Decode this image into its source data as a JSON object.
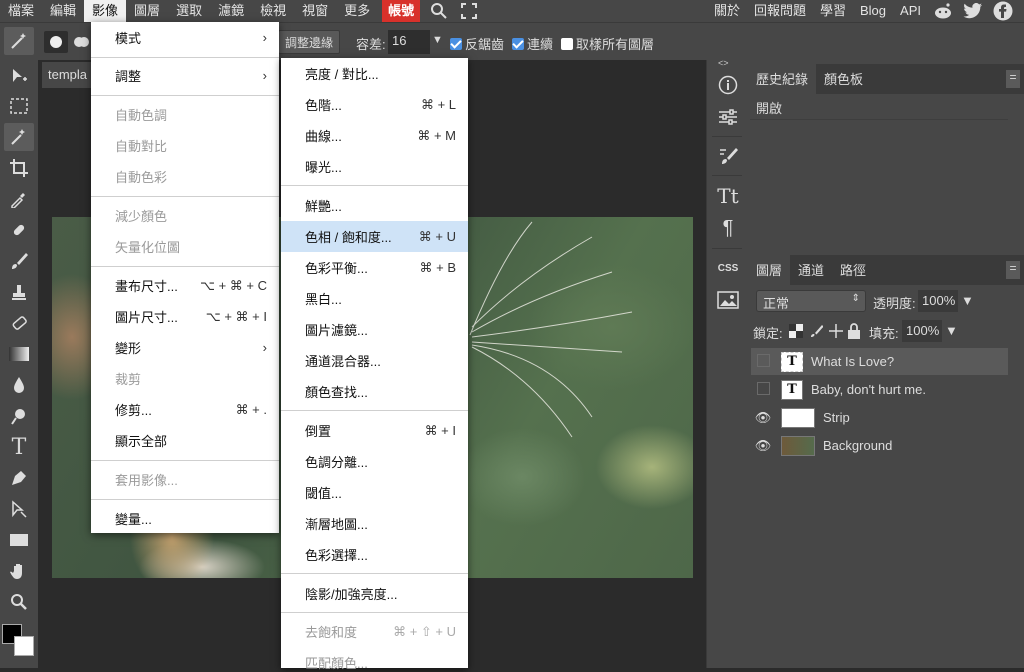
{
  "menubar": {
    "items": [
      "檔案",
      "編輯",
      "影像",
      "圖層",
      "選取",
      "濾鏡",
      "檢視",
      "視窗",
      "更多"
    ],
    "account": "帳號",
    "right_items": [
      "關於",
      "回報問題",
      "學習",
      "Blog",
      "API"
    ],
    "icons": [
      "search-icon",
      "fullscreen-icon",
      "reddit-icon",
      "twitter-icon",
      "facebook-icon"
    ]
  },
  "options": {
    "refine_edge": "調整邊緣",
    "tolerance_label": "容差:",
    "tolerance_value": "16",
    "antialias": "反鋸齒",
    "contiguous": "連續",
    "sample_all": "取樣所有圖層"
  },
  "document": {
    "tab_label": "templa"
  },
  "image_menu": {
    "items": [
      {
        "label": "模式",
        "submenu": true,
        "disabled": false
      },
      {
        "label": "調整",
        "submenu": true,
        "disabled": false
      },
      {
        "label": "自動色調",
        "disabled": true
      },
      {
        "label": "自動對比",
        "disabled": true
      },
      {
        "label": "自動色彩",
        "disabled": true
      },
      {
        "label": "減少顏色",
        "disabled": true
      },
      {
        "label": "矢量化位圖",
        "disabled": true
      },
      {
        "label": "畫布尺寸...",
        "shortcut": "⌥ + ⌘ + C"
      },
      {
        "label": "圖片尺寸...",
        "shortcut": "⌥ + ⌘ + I"
      },
      {
        "label": "變形",
        "submenu": true
      },
      {
        "label": "裁剪",
        "disabled": true
      },
      {
        "label": "修剪...",
        "shortcut": "⌘ + ."
      },
      {
        "label": "顯示全部"
      },
      {
        "label": "套用影像...",
        "disabled": true
      },
      {
        "label": "變量..."
      }
    ]
  },
  "adjust_menu": {
    "items": [
      {
        "label": "亮度 / 對比..."
      },
      {
        "label": "色階...",
        "shortcut": "⌘ + L"
      },
      {
        "label": "曲線...",
        "shortcut": "⌘ + M"
      },
      {
        "label": "曝光..."
      },
      {
        "label": "鮮艷..."
      },
      {
        "label": "色相 / 飽和度...",
        "shortcut": "⌘ + U",
        "highlight": true
      },
      {
        "label": "色彩平衡...",
        "shortcut": "⌘ + B"
      },
      {
        "label": "黑白..."
      },
      {
        "label": "圖片濾鏡..."
      },
      {
        "label": "通道混合器..."
      },
      {
        "label": "顏色查找..."
      },
      {
        "label": "倒置",
        "shortcut": "⌘ + I"
      },
      {
        "label": "色調分離..."
      },
      {
        "label": "閾值..."
      },
      {
        "label": "漸層地圖..."
      },
      {
        "label": "色彩選擇..."
      },
      {
        "label": "陰影/加強亮度..."
      },
      {
        "label": "去飽和度",
        "shortcut": "⌘ + ⇧ + U",
        "disabled": true
      },
      {
        "label": "匹配顏色...",
        "disabled": true
      }
    ]
  },
  "history_panel": {
    "tabs": [
      "歷史紀錄",
      "顏色板"
    ],
    "entries": [
      "開啟"
    ]
  },
  "layers_panel": {
    "tabs": [
      "圖層",
      "通道",
      "路徑"
    ],
    "blend_mode": "正常",
    "opacity_label": "透明度:",
    "opacity_value": "100%",
    "lock_label": "鎖定:",
    "fill_label": "填充:",
    "fill_value": "100%",
    "layers": [
      {
        "name": "What Is Love?",
        "type": "text",
        "visible": false,
        "selected": true
      },
      {
        "name": "Baby, don't hurt me.",
        "type": "text",
        "visible": false,
        "selected": false
      },
      {
        "name": "Strip",
        "type": "raster",
        "visible": true,
        "selected": false
      },
      {
        "name": "Background",
        "type": "image",
        "visible": true,
        "selected": false
      }
    ]
  },
  "side_panel": {
    "css_label": "CSS",
    "type_label": "Tt",
    "collapse_left": "<>",
    "collapse_right": "><"
  },
  "colors": {
    "accent": "#d8312b",
    "highlight": "#cfe3f7",
    "checkbox": "#4a90e2"
  }
}
